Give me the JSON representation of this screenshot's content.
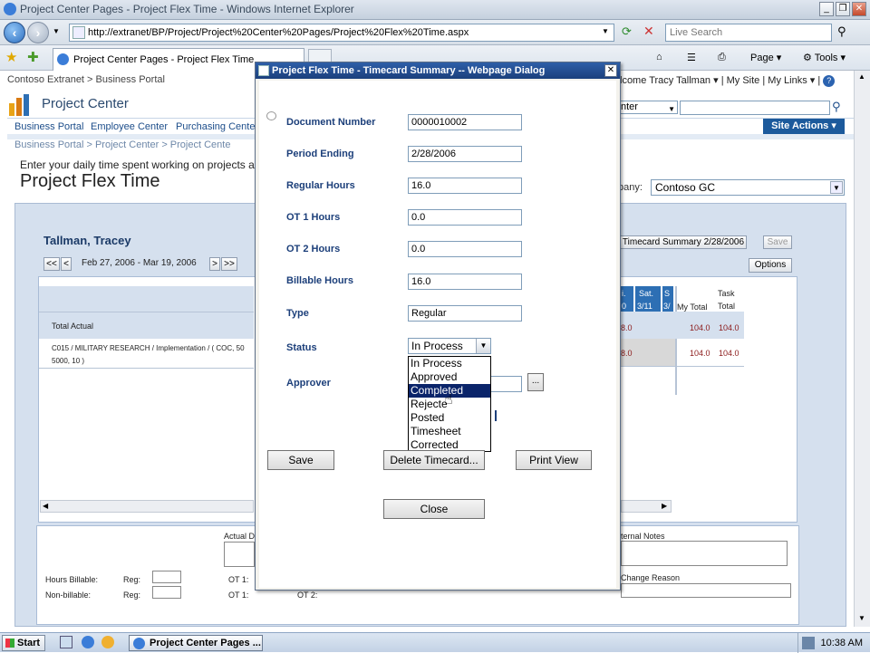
{
  "window": {
    "title": "Project Center Pages - Project Flex Time - Windows Internet Explorer"
  },
  "browser": {
    "address": "http://extranet/BP/Project/Project%20Center%20Pages/Project%20Flex%20Time.aspx",
    "search_placeholder": "Live Search",
    "tab_label": "Project Center Pages - Project Flex Time",
    "page_menu": "Page",
    "tools_menu": "Tools"
  },
  "site": {
    "breadcrumb_top": "Contoso Extranet > Business Portal",
    "welcome": "lcome Tracy Tallman",
    "my_site": "My Site",
    "my_links": "My Links",
    "title": "Project Center",
    "nav": [
      "Business Portal",
      "Employee Center",
      "Purchasing Center"
    ],
    "scope_select": "nter",
    "site_actions": "Site Actions"
  },
  "page": {
    "breadcrumb": "Business Portal > Project Center > Project Cente",
    "description": "Enter your daily time spent working on projects and",
    "title": "Project Flex Time",
    "company_label": "pany:",
    "company_value": "Contoso GC",
    "person": "Tallman, Tracey",
    "date_range": "Feb 27, 2006 - Mar 19, 2006",
    "timecard_summary_btn": "Timecard Summary 2/28/2006",
    "save_btn": "Save",
    "options_btn": "Options",
    "total_actual": "Total Actual",
    "row_text_1": "C015 / MILITARY RESEARCH / Implementation / ( COC, 50",
    "row_text_2": "5000, 10 )",
    "col_headers": [
      {
        "day": "i.",
        "date": "0"
      },
      {
        "day": "Sat.",
        "date": "3/11"
      },
      {
        "day": "S",
        "date": "3/"
      }
    ],
    "my_total_label": "My Total",
    "task_label": "Task",
    "task_total_label": "Total",
    "partial_value": "8.0",
    "my_total_value": "104.0",
    "task_total_value": "104.0",
    "bottom": {
      "actual_label": "Actual D",
      "internal_notes": "ternal Notes",
      "change_reason": "Change Reason",
      "hours_billable": "Hours Billable:",
      "non_billable": "Non-billable:",
      "reg": "Reg:",
      "ot1": "OT 1:",
      "ot2": "OT 2:"
    }
  },
  "dialog": {
    "title": "Project Flex Time - Timecard Summary -- Webpage Dialog",
    "fields": {
      "document_number": {
        "label": "Document Number",
        "value": "0000010002"
      },
      "period_ending": {
        "label": "Period Ending",
        "value": "2/28/2006"
      },
      "regular_hours": {
        "label": "Regular Hours",
        "value": "16.0"
      },
      "ot1_hours": {
        "label": "OT 1 Hours",
        "value": "0.0"
      },
      "ot2_hours": {
        "label": "OT 2 Hours",
        "value": "0.0"
      },
      "billable_hours": {
        "label": "Billable Hours",
        "value": "16.0"
      },
      "type": {
        "label": "Type",
        "value": "Regular"
      },
      "status": {
        "label": "Status",
        "value": "In Process"
      },
      "approver": {
        "label": "Approver"
      }
    },
    "status_options": [
      "In Process",
      "Approved",
      "Completed",
      "Rejecte",
      "Posted",
      "Timesheet",
      "Corrected"
    ],
    "approver_browse": "...",
    "buttons": {
      "save": "Save",
      "delete": "Delete Timecard...",
      "print": "Print View",
      "close": "Close"
    }
  },
  "taskbar": {
    "start": "Start",
    "task_item": "Project Center Pages ...",
    "clock": "10:38 AM"
  },
  "colors": {
    "title_bar": "#1b3f7c",
    "label_blue": "#1c3f7a",
    "selection": "#0a246a",
    "site_actions": "#1c5a9c"
  }
}
